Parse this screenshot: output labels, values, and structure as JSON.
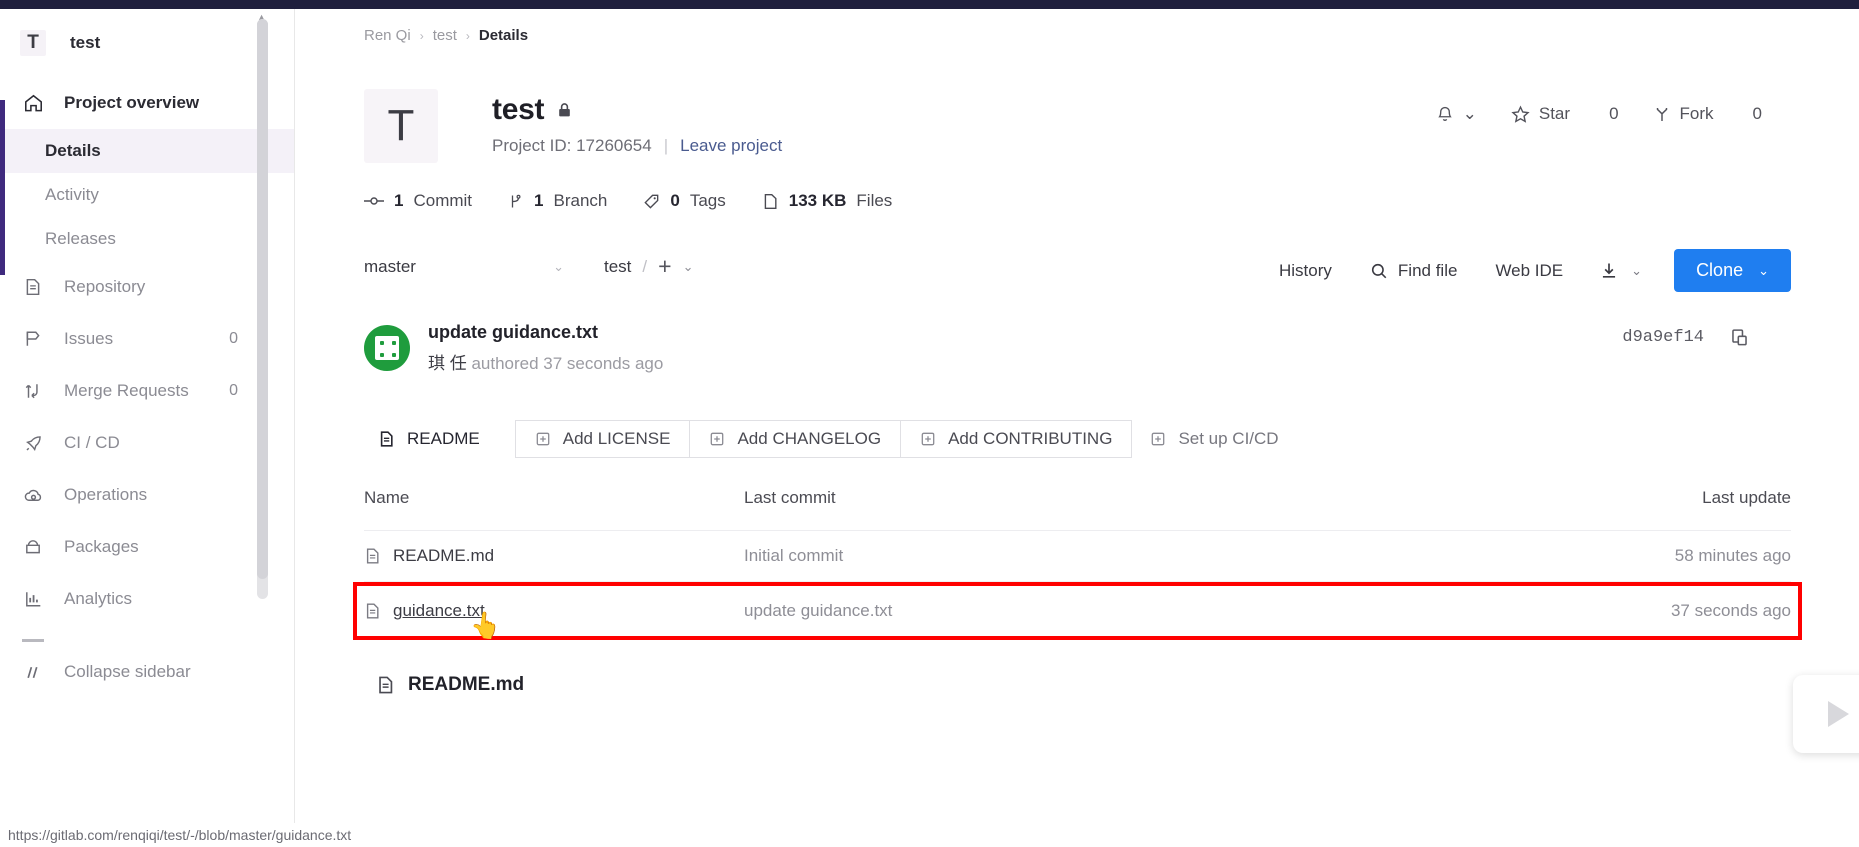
{
  "sidebar": {
    "project": {
      "avatar_letter": "T",
      "name": "test"
    },
    "items": [
      {
        "label": "Project overview",
        "icon": "home-icon",
        "count": "",
        "active": true
      },
      {
        "label": "Repository",
        "icon": "document-icon",
        "count": ""
      },
      {
        "label": "Issues",
        "icon": "issues-icon",
        "count": "0"
      },
      {
        "label": "Merge Requests",
        "icon": "merge-request-icon",
        "count": "0"
      },
      {
        "label": "CI / CD",
        "icon": "rocket-icon",
        "count": ""
      },
      {
        "label": "Operations",
        "icon": "cloud-gear-icon",
        "count": ""
      },
      {
        "label": "Packages",
        "icon": "package-icon",
        "count": ""
      },
      {
        "label": "Analytics",
        "icon": "chart-icon",
        "count": ""
      }
    ],
    "sub_items": [
      {
        "label": "Details",
        "selected": true
      },
      {
        "label": "Activity",
        "selected": false
      },
      {
        "label": "Releases",
        "selected": false
      }
    ],
    "collapse_label": "Collapse sidebar"
  },
  "breadcrumb": {
    "items": [
      "Ren Qi",
      "test",
      "Details"
    ],
    "separator": "›"
  },
  "project": {
    "avatar_letter": "T",
    "title": "test",
    "visibility_icon": "lock-icon",
    "project_id_label": "Project ID: 17260654",
    "leave_label": "Leave project"
  },
  "header_actions": {
    "notification_icon": "bell-icon",
    "notification_caret": "⌄",
    "star_label": "Star",
    "star_count": "0",
    "star_icon": "star-icon",
    "fork_label": "Fork",
    "fork_count": "0",
    "fork_icon": "fork-icon"
  },
  "stats": [
    {
      "icon": "commit-icon",
      "value": "1",
      "label": "Commit"
    },
    {
      "icon": "branch-icon",
      "value": "1",
      "label": "Branch"
    },
    {
      "icon": "tag-icon",
      "value": "0",
      "label": "Tags"
    },
    {
      "icon": "file-icon",
      "value": "133 KB",
      "label": "Files"
    }
  ],
  "toolbar": {
    "branch": "master",
    "branch_caret": "⌄",
    "path_root": "test",
    "path_slash": "/",
    "add_plus": "+",
    "add_caret": "⌄",
    "history_label": "History",
    "find_file_label": "Find file",
    "find_file_icon": "search-icon",
    "web_ide_label": "Web IDE",
    "download_icon": "download-icon",
    "download_caret": "⌄",
    "clone_label": "Clone",
    "clone_caret": "⌄",
    "clone_color": "#1f7ef0"
  },
  "commit": {
    "message": "update guidance.txt",
    "author": "琪 任",
    "byline": "authored 37 seconds ago",
    "sha": "d9a9ef14",
    "copy_icon": "copy-icon"
  },
  "file_actions": [
    {
      "label": "README",
      "icon": "readme-icon",
      "style": "first"
    },
    {
      "label": "Add LICENSE",
      "icon": "plus-box-icon",
      "style": "outline"
    },
    {
      "label": "Add CHANGELOG",
      "icon": "plus-box-icon",
      "style": "outline"
    },
    {
      "label": "Add CONTRIBUTING",
      "icon": "plus-box-icon",
      "style": "outline"
    },
    {
      "label": "Set up CI/CD",
      "icon": "plus-box-icon",
      "style": "last"
    }
  ],
  "file_table": {
    "headers": {
      "name": "Name",
      "last_commit": "Last commit",
      "last_update": "Last update"
    },
    "rows": [
      {
        "name": "README.md",
        "last_commit": "Initial commit",
        "last_update": "58 minutes ago",
        "highlighted": false
      },
      {
        "name": "guidance.txt",
        "last_commit": "update guidance.txt",
        "last_update": "37 seconds ago",
        "highlighted": true
      }
    ],
    "highlight_color": "#ff0000"
  },
  "readme_footer": {
    "label": "README.md",
    "icon": "readme-icon"
  },
  "status_bar": {
    "url": "https://gitlab.com/renqiqi/test/-/blob/master/guidance.txt"
  },
  "video_widget": {
    "icon": "play-icon"
  }
}
